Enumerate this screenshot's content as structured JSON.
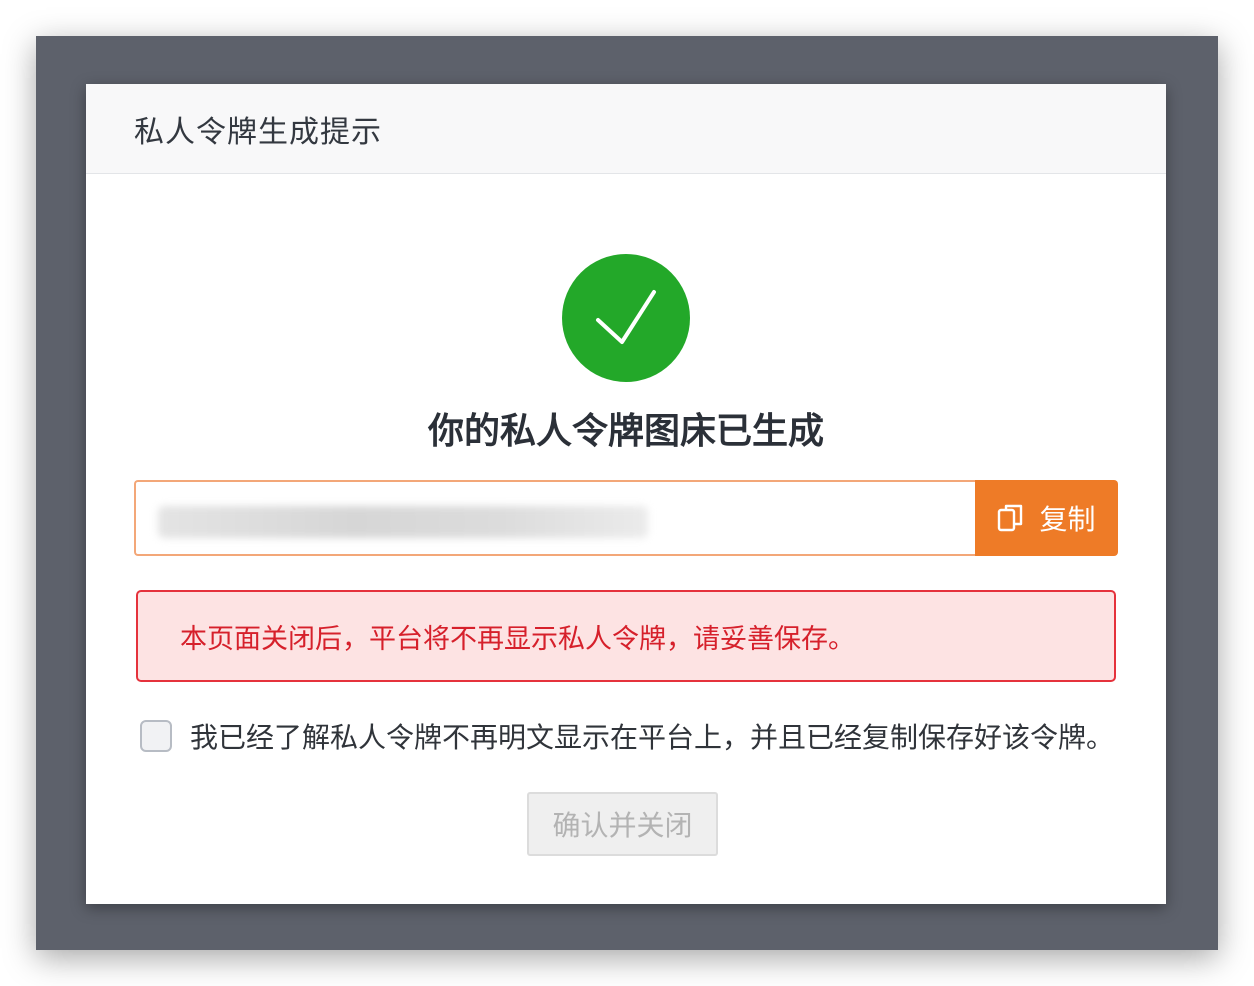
{
  "dialog": {
    "title": "私人令牌生成提示",
    "heading": "你的私人令牌图床已生成",
    "token_value": "",
    "copy_button_label": "复制",
    "warning_text": "本页面关闭后，平台将不再显示私人令牌，请妥善保存。",
    "checkbox_checked": false,
    "checkbox_label": "我已经了解私人令牌不再明文显示在平台上，并且已经复制保存好该令牌。",
    "confirm_button_label": "确认并关闭",
    "confirm_button_disabled": true
  },
  "icons": {
    "success": "check-circle-icon",
    "copy": "copy-icon"
  },
  "colors": {
    "success": "#23a829",
    "accent": "#ee7b27",
    "warning_text": "#d6202b",
    "warning_bg": "#fde3e3",
    "overlay": "#5d616b"
  }
}
